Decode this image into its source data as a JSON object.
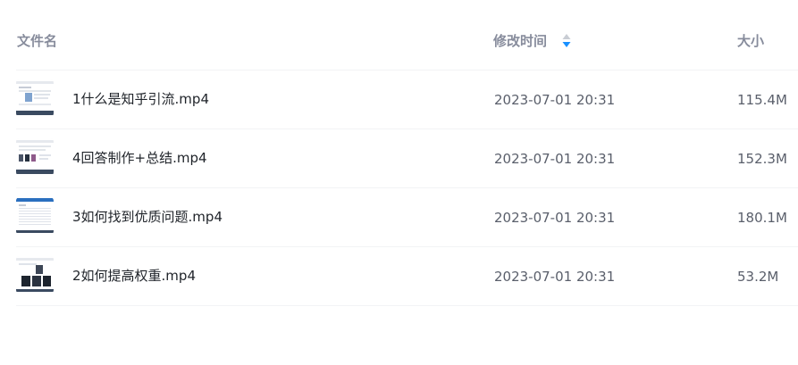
{
  "columns": {
    "name": "文件名",
    "modified": "修改时间",
    "size": "大小"
  },
  "sort": {
    "icon": "sort-arrows-icon",
    "active_color": "#1890ff",
    "inactive_color": "#c9cdd4"
  },
  "files": [
    {
      "name": "1什么是知乎引流.mp4",
      "modified": "2023-07-01 20:31",
      "size": "115.4M",
      "thumbnail": "video-thumbnail"
    },
    {
      "name": "4回答制作+总结.mp4",
      "modified": "2023-07-01 20:31",
      "size": "152.3M",
      "thumbnail": "video-thumbnail"
    },
    {
      "name": "3如何找到优质问题.mp4",
      "modified": "2023-07-01 20:31",
      "size": "180.1M",
      "thumbnail": "video-thumbnail"
    },
    {
      "name": "2如何提高权重.mp4",
      "modified": "2023-07-01 20:31",
      "size": "53.2M",
      "thumbnail": "video-thumbnail"
    }
  ]
}
